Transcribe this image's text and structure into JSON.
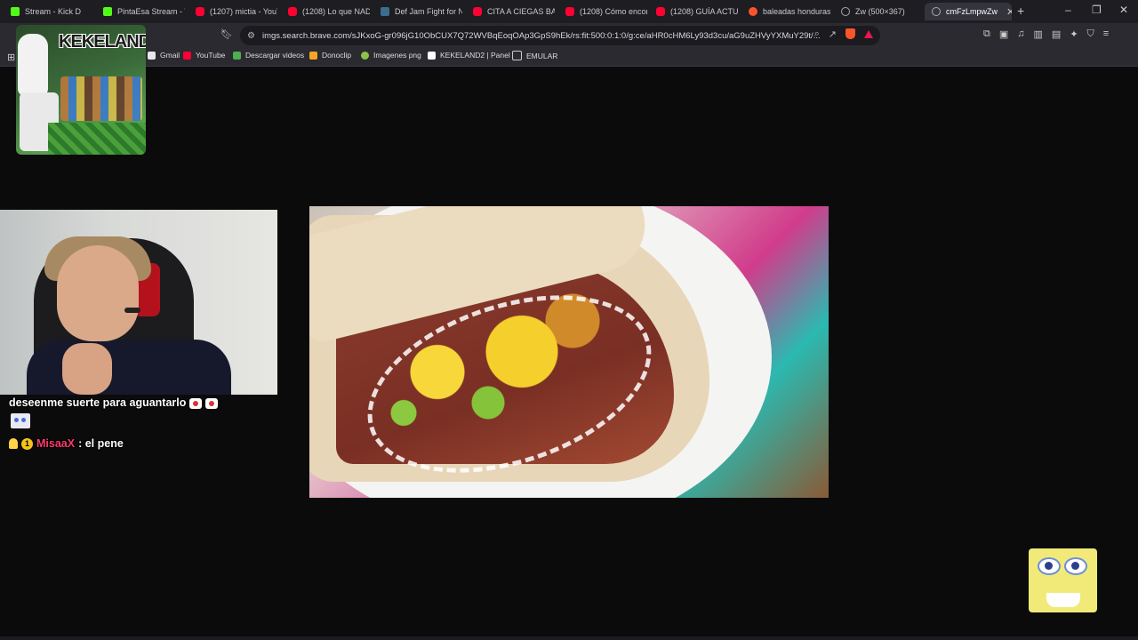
{
  "tabs": [
    {
      "label": "Stream - Kick D",
      "icon": "kick-icon"
    },
    {
      "label": "PintaEsa Stream - W",
      "icon": "kick-icon"
    },
    {
      "label": "(1207) mictia - YouT",
      "icon": "youtube-icon"
    },
    {
      "label": "(1208) Lo que NAD",
      "icon": "youtube-icon"
    },
    {
      "label": "Def Jam Fight for N",
      "icon": "page-icon"
    },
    {
      "label": "CITA A CIEGAS BAS",
      "icon": "youtube-icon"
    },
    {
      "label": "(1208) Cómo encon",
      "icon": "youtube-icon"
    },
    {
      "label": "(1208) GUÍA ACTUA",
      "icon": "youtube-icon"
    },
    {
      "label": "baleadas honduras",
      "icon": "brave-search-icon"
    },
    {
      "label": "Zw (500×367)",
      "icon": "globe-icon"
    },
    {
      "label": "cmFzLmpwZw",
      "icon": "globe-icon"
    }
  ],
  "address_bar": {
    "url": "imgs.search.brave.com/sJKxoG-gr096jG10ObCUX7Q72WVBqEoqOAp3GpS9hEk/rs:fit:500:0:1:0/g:ce/aHR0cHM6Ly93d3cu/aG9uZHVyYXMuY29t/..."
  },
  "bookmarks": [
    {
      "label": "Gmail",
      "color": "#e8e8e8"
    },
    {
      "label": "YouTube",
      "color": "#ff0033"
    },
    {
      "label": "Descargar videos",
      "color": "#4caf50"
    },
    {
      "label": "Donoclip",
      "color": "#f5a623"
    },
    {
      "label": "Imagenes png",
      "color": "#8bc34a"
    },
    {
      "label": "KEKELAND2 | Panel",
      "color": "#ffffff"
    },
    {
      "label": "EMULAR",
      "color": "#cccccc"
    }
  ],
  "stream": {
    "logo_text": "KEKELAND",
    "chat": {
      "line1": "deseenme suerte para aguantarlo",
      "username": "MisaaX",
      "message": ": el pene",
      "badge_number": "1"
    }
  },
  "colors": {
    "background": "#0b0b0c",
    "tabstrip": "#1d1d22",
    "toolbar": "#2a2a30",
    "chat_username": "#ff3a6e"
  }
}
